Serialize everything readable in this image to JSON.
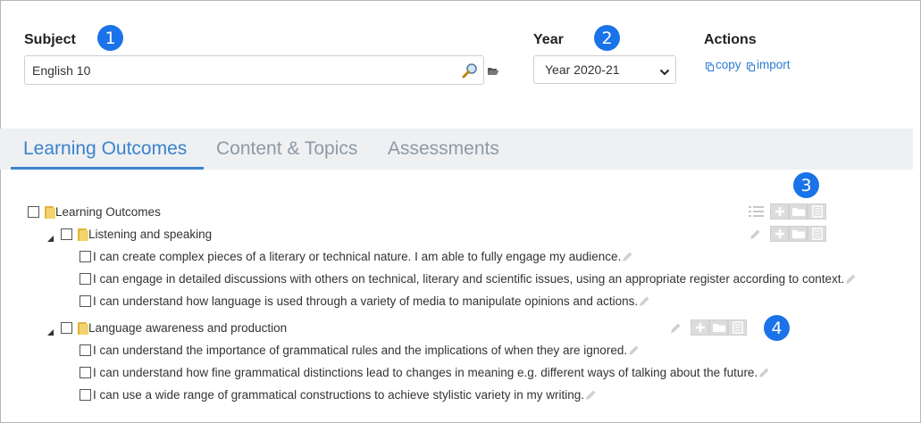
{
  "subject": {
    "label": "Subject",
    "value": "English 10",
    "badge": "1"
  },
  "year": {
    "label": "Year",
    "value": "Year 2020-21",
    "badge": "2"
  },
  "actions": {
    "label": "Actions",
    "copy": "copy",
    "import": "import"
  },
  "tabs": [
    {
      "label": "Learning Outcomes",
      "active": true
    },
    {
      "label": "Content & Topics",
      "active": false
    },
    {
      "label": "Assessments",
      "active": false
    }
  ],
  "badges": {
    "tools": "3",
    "group_tools": "4"
  },
  "tree": {
    "root": "Learning Outcomes",
    "groups": [
      {
        "label": "Listening and speaking",
        "items": [
          "I can create complex pieces of a literary or technical nature. I am able to fully engage my audience.",
          "I can engage in detailed discussions with others on technical, literary and scientific issues, using an appropriate register according to context.",
          "I can understand how language is used through a variety of media to manipulate opinions and actions."
        ]
      },
      {
        "label": "Language awareness and production",
        "items": [
          "I can understand the importance of grammatical rules and the implications of when they are ignored.",
          "I can understand how fine grammatical distinctions lead to changes in meaning e.g. different ways of talking about the future.",
          "I can use a wide range of grammatical constructions to achieve stylistic variety in my writing."
        ]
      }
    ]
  },
  "colors": {
    "accent": "#1a73e8",
    "link": "#2b7bd1",
    "tab_active": "#3b82cf",
    "tab_inactive": "#8e9aa4"
  }
}
